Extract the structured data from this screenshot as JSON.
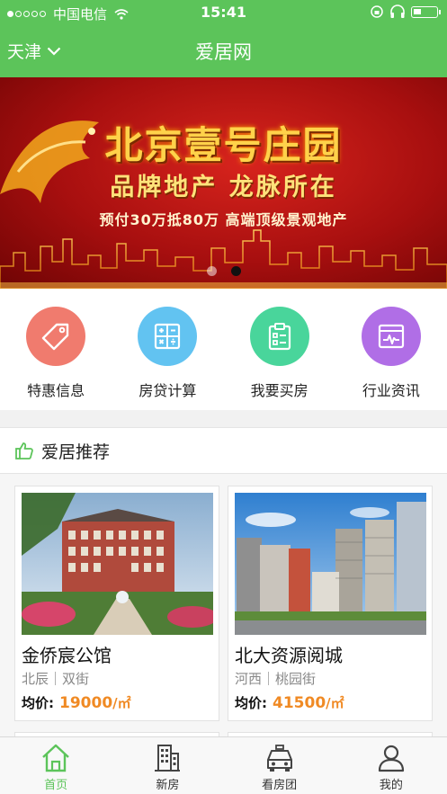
{
  "status_bar": {
    "carrier": "中国电信",
    "time": "15:41"
  },
  "nav": {
    "city": "天津",
    "title": "爱居网"
  },
  "banner": {
    "title": "北京壹号庄园",
    "subtitle": "品牌地产 龙脉所在",
    "desc": "预付30万抵80万 高端顶级景观地产",
    "slide_count": 2,
    "active_slide": 2
  },
  "quick_entries": [
    {
      "label": "特惠信息",
      "icon": "tag-icon",
      "color": "#f07b6e"
    },
    {
      "label": "房贷计算",
      "icon": "calculator-icon",
      "color": "#62c3f1"
    },
    {
      "label": "我要买房",
      "icon": "clipboard-icon",
      "color": "#49d59b"
    },
    {
      "label": "行业资讯",
      "icon": "monitor-chart-icon",
      "color": "#b06ee6"
    }
  ],
  "section": {
    "title": "爱居推荐",
    "icon": "thumbs-up-icon"
  },
  "listings": [
    {
      "name": "金侨宸公馆",
      "area": "北辰｜双街",
      "price_label": "均价:",
      "price": "19000",
      "unit": "/㎡"
    },
    {
      "name": "北大资源阅城",
      "area": "河西｜桃园街",
      "price_label": "均价:",
      "price": "41500",
      "unit": "/㎡"
    }
  ],
  "tabs": [
    {
      "label": "首页",
      "icon": "home-icon",
      "active": true
    },
    {
      "label": "新房",
      "icon": "building-icon",
      "active": false
    },
    {
      "label": "看房团",
      "icon": "car-icon",
      "active": false
    },
    {
      "label": "我的",
      "icon": "user-icon",
      "active": false
    }
  ],
  "colors": {
    "brand_green": "#5cc45a",
    "price_orange": "#f08a24"
  }
}
